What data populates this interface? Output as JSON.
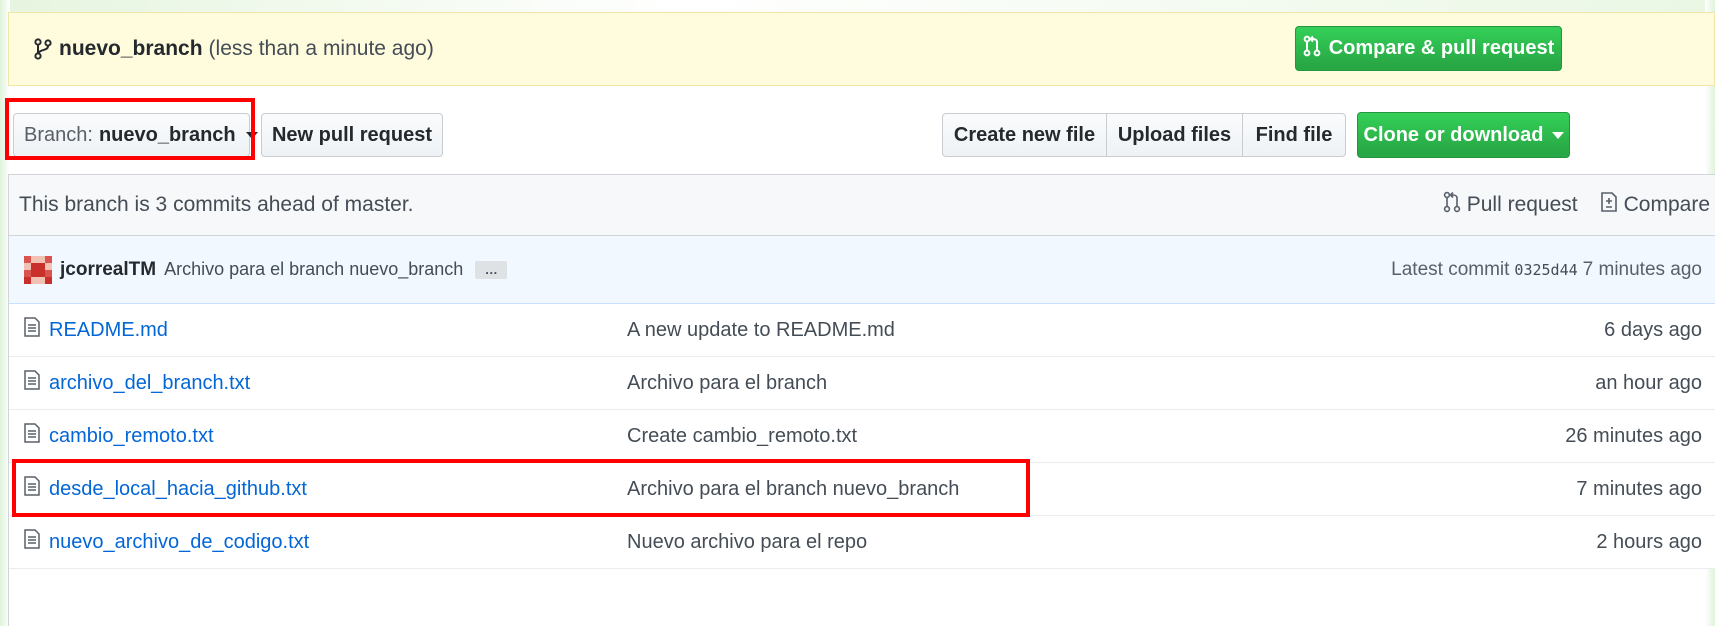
{
  "push_banner": {
    "branch": "nuevo_branch",
    "time": "(less than a minute ago)",
    "compare_label": "Compare & pull request"
  },
  "toolbar": {
    "branch_prefix": "Branch:",
    "branch_value": "nuevo_branch",
    "new_pr_label": "New pull request",
    "create_file_label": "Create new file",
    "upload_label": "Upload files",
    "find_label": "Find file",
    "clone_label": "Clone or download"
  },
  "ahead": {
    "text": "This branch is 3 commits ahead of master.",
    "pull_request_label": "Pull request",
    "compare_label": "Compare"
  },
  "latest_commit": {
    "author": "jcorrealTM",
    "message": "Archivo para el branch nuevo_branch",
    "ellipsis": "…",
    "prefix": "Latest commit",
    "sha": "0325d44",
    "age": "7 minutes ago"
  },
  "files": [
    {
      "name": "README.md",
      "message": "A new update to README.md",
      "age": "6 days ago"
    },
    {
      "name": "archivo_del_branch.txt",
      "message": "Archivo para el branch",
      "age": "an hour ago"
    },
    {
      "name": "cambio_remoto.txt",
      "message": "Create cambio_remoto.txt",
      "age": "26 minutes ago"
    },
    {
      "name": "desde_local_hacia_github.txt",
      "message": "Archivo para el branch nuevo_branch",
      "age": "7 minutes ago"
    },
    {
      "name": "nuevo_archivo_de_codigo.txt",
      "message": "Nuevo archivo para el repo",
      "age": "2 hours ago"
    }
  ],
  "colors": {
    "link": "#0366d6",
    "green_button": "#28a745",
    "banner": "#fffbdd",
    "annotation": "#ff0000"
  }
}
